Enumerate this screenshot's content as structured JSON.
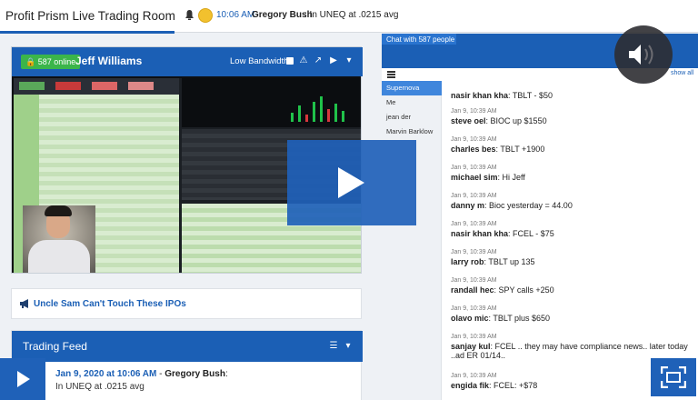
{
  "app": {
    "title": "Profit Prism Live Trading Room"
  },
  "notification": {
    "time": "10:06 AM",
    "user": "Gregory Bush",
    "text": ": In UNEQ at .0215 avg"
  },
  "video": {
    "online_count": "587 online",
    "presenter": "Jeff Williams",
    "bandwidth_label": "Low Bandwidth"
  },
  "promo": {
    "link_text": "Uncle Sam Can't Touch These IPOs"
  },
  "feed": {
    "title": "Trading Feed",
    "entry_time": "Jan 9, 2020 at 10:06 AM",
    "entry_sep": " - ",
    "entry_user": "Gregory Bush",
    "entry_colon": ":",
    "entry_text": "In UNEQ at .0215 avg"
  },
  "chat": {
    "tab_label": "Chat with 587 people",
    "show_all": "show all",
    "members": [
      "Supernova",
      "Me",
      "jean der",
      "Marvin Barklow"
    ],
    "messages": [
      {
        "time": "",
        "user": "nasir khan kha",
        "text": ": TBLT - $50"
      },
      {
        "time": "Jan 9, 10:39 AM",
        "user": "steve oel",
        "text": ": BIOC up $1550"
      },
      {
        "time": "Jan 9, 10:39 AM",
        "user": "charles bes",
        "text": ": TBLT +1900"
      },
      {
        "time": "Jan 9, 10:39 AM",
        "user": "michael sim",
        "text": ": Hi Jeff"
      },
      {
        "time": "Jan 9, 10:39 AM",
        "user": "danny m",
        "text": ": Bioc yesterday = 44.00"
      },
      {
        "time": "Jan 9, 10:39 AM",
        "user": "nasir khan kha",
        "text": ": FCEL - $75"
      },
      {
        "time": "Jan 9, 10:39 AM",
        "user": "larry rob",
        "text": ": TBLT up 135"
      },
      {
        "time": "Jan 9, 10:39 AM",
        "user": "randall hec",
        "text": ": SPY calls +250"
      },
      {
        "time": "Jan 9, 10:39 AM",
        "user": "olavo mic",
        "text": ": TBLT plus $650"
      },
      {
        "time": "Jan 9, 10:39 AM",
        "user": "sanjay kul",
        "text": ": FCEL .. they may have compliance news.. later today ..ad ER 01/14.."
      },
      {
        "time": "Jan 9, 10:39 AM",
        "user": "engida fik",
        "text": ": FCEL: +$78"
      }
    ]
  },
  "colors": {
    "brand": "#1b5fb5",
    "online": "#3bb54a"
  },
  "icons": [
    "bell-icon",
    "coin-icon",
    "lock-icon",
    "warning-icon",
    "popout-icon",
    "camera-icon",
    "chevron-down-icon",
    "megaphone-icon",
    "list-icon",
    "hamburger-icon",
    "play-icon",
    "volume-icon",
    "fullscreen-icon"
  ]
}
